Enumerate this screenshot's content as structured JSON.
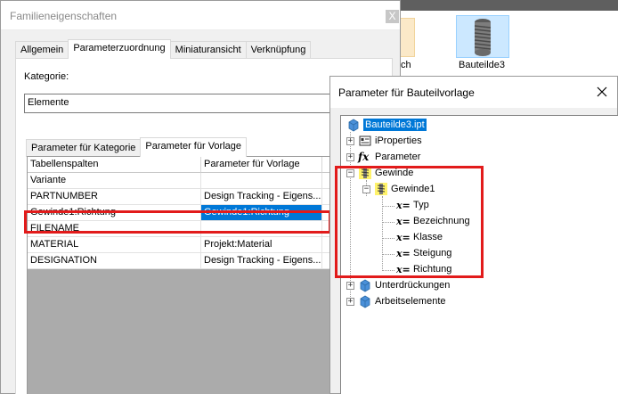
{
  "background": {
    "left_thumb_label": "ch",
    "bolt_thumb_label": "Bauteilde3"
  },
  "family_dialog": {
    "title": "Familieneigenschaften",
    "close_label": "X",
    "tabs": [
      {
        "label": "Allgemein"
      },
      {
        "label": "Parameterzuordnung"
      },
      {
        "label": "Miniaturansicht"
      },
      {
        "label": "Verknüpfung"
      }
    ],
    "active_tab": "Parameterzuordnung",
    "kategorie_label": "Kategorie:",
    "kategorie_value": "Elemente",
    "sub_tabs": [
      {
        "label": "Parameter für Kategorie"
      },
      {
        "label": "Parameter für Vorlage"
      }
    ],
    "active_sub_tab": "Parameter für Vorlage",
    "table": {
      "columns": [
        "Tabellenspalten",
        "Parameter für Vorlage",
        ""
      ],
      "rows": [
        [
          "Variante",
          "",
          ""
        ],
        [
          "PARTNUMBER",
          "Design Tracking - Eigens...",
          ""
        ],
        [
          "Gewinde1:Richtung",
          "Gewinde1:Richtung",
          ""
        ],
        [
          "FILENAME",
          "",
          ""
        ],
        [
          "MATERIAL",
          "Projekt:Material",
          ""
        ],
        [
          "DESIGNATION",
          "Design Tracking - Eigens...",
          ""
        ]
      ],
      "selected_row_index": 2
    }
  },
  "tree_dialog": {
    "title": "Parameter für Bauteilvorlage",
    "items": {
      "root": "Bauteilde3.ipt",
      "iproperties": "iProperties",
      "parameter": "Parameter",
      "gewinde": "Gewinde",
      "gewinde1": "Gewinde1",
      "typ": "Typ",
      "bezeichnung": "Bezeichnung",
      "klasse": "Klasse",
      "steigung": "Steigung",
      "richtung": "Richtung",
      "unterdrueckungen": "Unterdrückungen",
      "arbeitselemente": "Arbeitselemente"
    },
    "param_glyph": "x=",
    "fx_glyph": "fx",
    "expand_collapsed": "+",
    "expand_expanded": "−"
  },
  "colors": {
    "selection": "#0078d7",
    "highlight_box": "#e21b1b",
    "part_icon": "#4a90d9"
  }
}
